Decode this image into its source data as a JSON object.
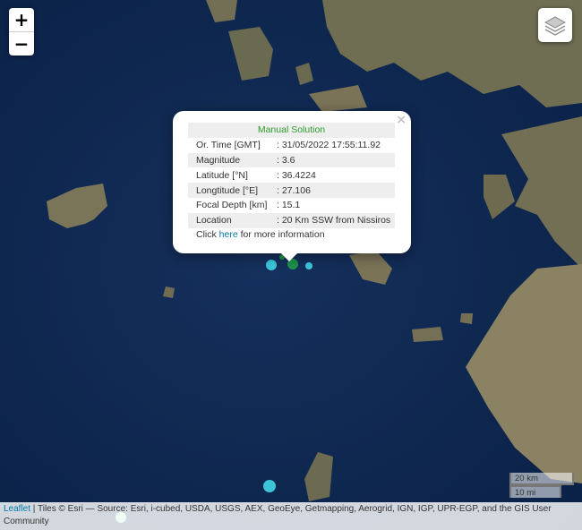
{
  "zoom": {
    "in_label": "+",
    "out_label": "−"
  },
  "layers_control": {
    "icon": "layers-icon"
  },
  "popup": {
    "title": "Manual Solution",
    "rows": [
      {
        "label": "Or. Time [GMT]",
        "value": ": 31/05/2022 17:55:11.92"
      },
      {
        "label": "Magnitude",
        "value": ": 3.6"
      },
      {
        "label": "Latitude [°N]",
        "value": ": 36.4224"
      },
      {
        "label": "Longtitude [°E]",
        "value": ": 27.106"
      },
      {
        "label": "Focal Depth [km]",
        "value": ": 15.1"
      },
      {
        "label": "Location",
        "value": ": 20 Km SSW from Nissiros"
      }
    ],
    "link_prefix": "Click ",
    "link_text": "here",
    "link_suffix": " for more information",
    "close_label": "×"
  },
  "scale": {
    "km_label": "20 km",
    "mi_label": "10 mi"
  },
  "attribution": {
    "leaflet": "Leaflet",
    "text": " | Tiles © Esri — Source: Esri, i-cubed, USDA, USGS, AEX, GeoEye, Getmapping, Aerogrid, IGN, IGP, UPR-EGP, and the GIS User Community"
  },
  "colors": {
    "sea": "#0d2a52",
    "land": "#7a7558",
    "event_selected": "#1f8f4a",
    "event_other": "#3cc4d8",
    "title_green": "#2e9b2e",
    "link": "#0078a8"
  }
}
